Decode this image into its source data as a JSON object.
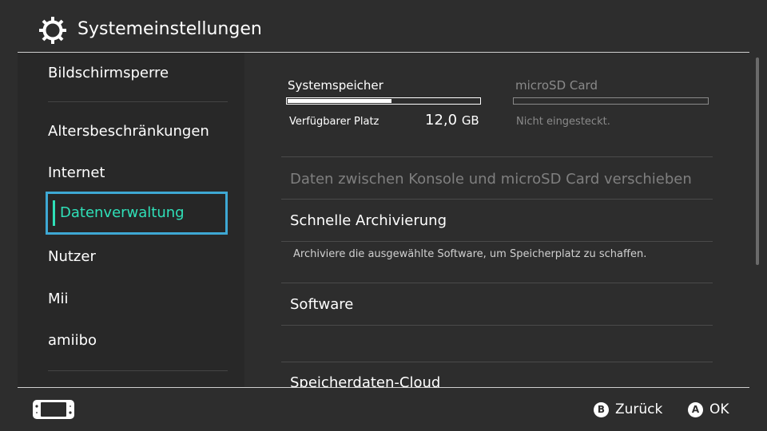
{
  "header": {
    "title": "Systemeinstellungen",
    "icon": "gear-icon"
  },
  "sidebar": {
    "items": [
      {
        "label": "Bildschirmsperre"
      },
      {
        "label": "Altersbeschränkungen"
      },
      {
        "label": "Internet"
      },
      {
        "label": "Datenverwaltung",
        "selected": true
      },
      {
        "label": "Nutzer"
      },
      {
        "label": "Mii"
      },
      {
        "label": "amiibo"
      }
    ],
    "accent_color": "#2fe0b8",
    "selection_border_color": "#3ea8d4"
  },
  "storage": {
    "system": {
      "label": "Systemspeicher",
      "free_label": "Verfügbarer Platz",
      "free_value": "12,0",
      "free_unit": "GB",
      "used_fraction": 0.54
    },
    "sd": {
      "label": "microSD Card",
      "status": "Nicht eingesteckt."
    }
  },
  "list": {
    "move_data": "Daten zwischen Konsole und microSD Card verschieben",
    "quick_archive": "Schnelle Archivierung",
    "quick_archive_desc": "Archiviere die ausgewählte Software, um Speicherplatz zu schaffen.",
    "software": "Software",
    "cloud": "Speicherdaten-Cloud"
  },
  "footer": {
    "back_button": "B",
    "back_label": "Zurück",
    "ok_button": "A",
    "ok_label": "OK",
    "console_icon": "switch-console-icon"
  }
}
